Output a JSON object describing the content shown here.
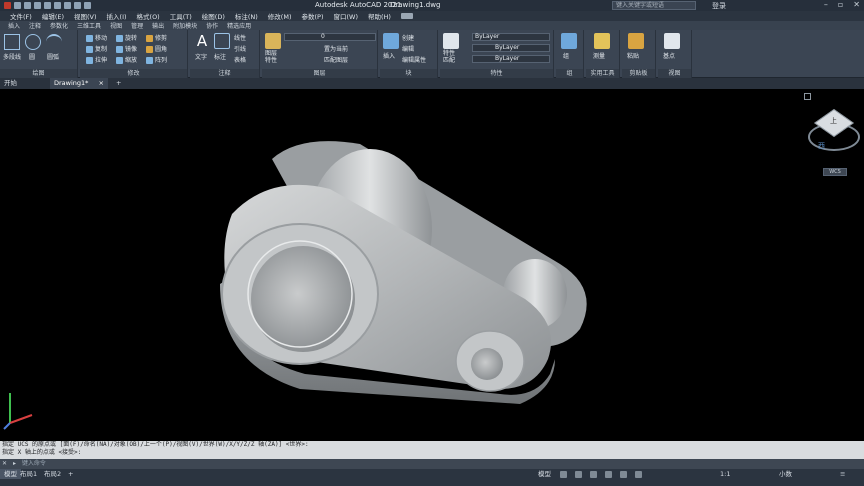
{
  "titlebar": {
    "app_title": "Autodesk AutoCAD 2021",
    "file_title": "Drawing1.dwg",
    "search_placeholder": "键入关键字或短语",
    "login_label": "登录"
  },
  "menu": [
    "文件(F)",
    "编辑(E)",
    "视图(V)",
    "插入(I)",
    "格式(O)",
    "工具(T)",
    "绘图(D)",
    "标注(N)",
    "修改(M)",
    "参数(P)",
    "窗口(W)",
    "帮助(H)"
  ],
  "ribbon_tabs": [
    "插入",
    "注释",
    "参数化",
    "三维工具",
    "视图",
    "管理",
    "输出",
    "附加模块",
    "协作",
    "精选应用"
  ],
  "ribbon": {
    "draw": {
      "title": "绘图",
      "polyline": "多段线",
      "circle": "圆",
      "arc": "圆弧"
    },
    "modify": {
      "title": "修改",
      "move": "移动",
      "rotate": "旋转",
      "trim": "修剪",
      "copy": "复制",
      "mirror": "镜像",
      "fillet": "圆角",
      "stretch": "拉伸",
      "scale": "缩放",
      "array": "阵列"
    },
    "annotation": {
      "title": "注释",
      "text": "文字",
      "dimension": "标注",
      "linear": "线性",
      "leader": "引线",
      "table": "表格"
    },
    "layers": {
      "title": "图层",
      "layer_props": "图层\n特性",
      "current_layer": "0",
      "set_current": "置为当前",
      "match_layer": "匹配图层"
    },
    "block": {
      "title": "块",
      "insert": "插入",
      "create": "创建",
      "edit": "编辑",
      "edit_attr": "编辑属性"
    },
    "properties": {
      "title": "特性",
      "match": "特性\n匹配",
      "color": "ByLayer",
      "linetype": "ByLayer",
      "lineweight": "ByLayer"
    },
    "groups": {
      "title": "组",
      "group": "组"
    },
    "utilities": {
      "title": "实用工具",
      "measure": "测量"
    },
    "clipboard": {
      "title": "剪贴板",
      "paste": "粘贴"
    },
    "view": {
      "title": "视图",
      "base": "基点"
    }
  },
  "file_tabs": [
    "开始",
    "Drawing1*"
  ],
  "viewport": {
    "viewcube_face": "上",
    "viewcube_compass": "西",
    "wcs_label": "WCS"
  },
  "command": {
    "history_line1": "指定 UCS 的原点或 [面(F)/命名(NA)/对象(OB)/上一个(P)/视图(V)/世界(W)/X/Y/Z/Z 轴(ZA)] <世界>:",
    "history_line2": "指定 X 轴上的点或 <接受>:",
    "prompt_placeholder": "键入命令"
  },
  "status": {
    "tabs": [
      "模型",
      "布局1",
      "布局2"
    ],
    "model_label": "模型",
    "scale_label": "1:1",
    "units_label": "小数"
  },
  "colors": {
    "titlebar": "#262f3b",
    "ribbon": "#3b4553",
    "viewport": "#000000",
    "part": "#b8bbbd"
  }
}
